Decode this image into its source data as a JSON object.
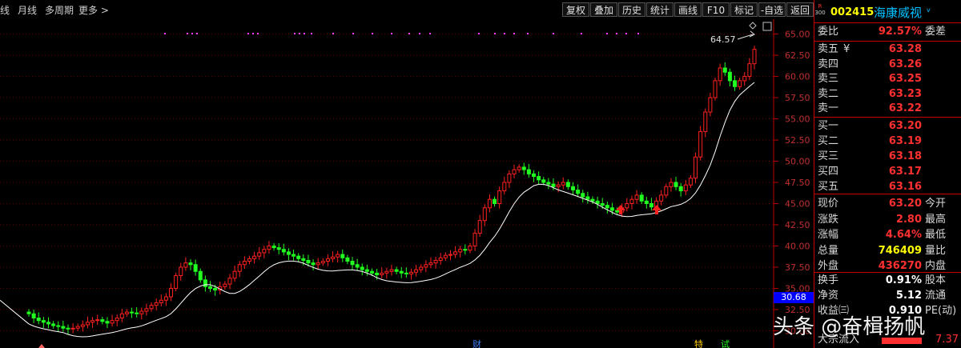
{
  "toolbar": {
    "left_items": [
      "线",
      "月线",
      "多周期",
      "更多"
    ],
    "buttons": [
      "复权",
      "叠加",
      "历史",
      "统计",
      "画线",
      "F10",
      "标记",
      "-自选",
      "返回"
    ]
  },
  "stock": {
    "code": "002415",
    "name": "海康威视",
    "prefix_top": "R",
    "prefix_bottom": "300"
  },
  "chart": {
    "y_ticks": [
      "65.00",
      "62.50",
      "60.00",
      "57.50",
      "55.00",
      "52.50",
      "50.00",
      "47.50",
      "45.00",
      "42.50",
      "40.00",
      "37.50",
      "35.00",
      "32.50",
      "30.00"
    ],
    "high_label": "64.57",
    "current_price_tag": "30.68",
    "bottom_marks": [
      "财",
      "特",
      "试"
    ]
  },
  "chart_data": {
    "type": "candlestick",
    "ylim": [
      29.0,
      66.0
    ],
    "close": [
      32.0,
      31.5,
      31.2,
      31.0,
      30.8,
      30.6,
      30.5,
      30.3,
      30.2,
      30.3,
      30.5,
      30.7,
      31.0,
      31.2,
      31.3,
      31.1,
      30.9,
      31.2,
      31.5,
      32.0,
      32.2,
      32.1,
      32.0,
      32.3,
      32.6,
      33.0,
      33.3,
      33.6,
      34.0,
      35.0,
      36.5,
      37.5,
      38.0,
      37.8,
      37.0,
      36.0,
      35.2,
      35.0,
      34.8,
      35.2,
      35.5,
      36.2,
      37.0,
      37.8,
      38.2,
      38.5,
      38.8,
      39.2,
      39.6,
      40.0,
      39.8,
      39.6,
      39.3,
      39.0,
      38.8,
      38.5,
      38.3,
      38.0,
      37.8,
      38.0,
      38.2,
      38.5,
      38.7,
      39.0,
      38.6,
      38.2,
      37.8,
      37.5,
      37.2,
      37.0,
      36.8,
      36.6,
      36.8,
      37.0,
      37.2,
      37.0,
      36.8,
      36.7,
      36.9,
      37.2,
      37.5,
      37.8,
      38.0,
      38.3,
      38.6,
      38.9,
      39.0,
      39.3,
      39.6,
      39.5,
      40.0,
      41.5,
      43.0,
      44.5,
      45.5,
      45.0,
      46.5,
      47.5,
      48.5,
      49.0,
      49.3,
      49.0,
      48.5,
      48.2,
      47.8,
      47.5,
      47.3,
      47.0,
      47.2,
      47.5,
      47.0,
      46.6,
      46.2,
      45.8,
      45.5,
      45.3,
      45.0,
      44.8,
      44.5,
      44.2,
      44.0,
      44.5,
      45.0,
      45.5,
      46.0,
      45.3,
      45.0,
      44.6,
      45.3,
      46.0,
      47.0,
      47.5,
      47.0,
      46.5,
      47.2,
      48.0,
      50.5,
      53.5,
      55.8,
      57.5,
      59.5,
      61.0,
      60.5,
      59.5,
      58.8,
      59.5,
      60.0,
      61.5,
      63.2
    ]
  },
  "panel": {
    "weibi": {
      "label": "委比",
      "value": "92.57%",
      "label2": "委差"
    },
    "asks": [
      {
        "label": "卖五",
        "extra": "¥",
        "price": "63.28"
      },
      {
        "label": "卖四",
        "extra": "",
        "price": "63.26"
      },
      {
        "label": "卖三",
        "extra": "",
        "price": "63.25"
      },
      {
        "label": "卖二",
        "extra": "",
        "price": "63.23"
      },
      {
        "label": "卖一",
        "extra": "",
        "price": "63.22"
      }
    ],
    "bids": [
      {
        "label": "买一",
        "price": "63.20"
      },
      {
        "label": "买二",
        "price": "63.19"
      },
      {
        "label": "买三",
        "price": "63.18"
      },
      {
        "label": "买四",
        "price": "63.17"
      },
      {
        "label": "买五",
        "price": "63.16"
      }
    ],
    "stats": [
      {
        "label": "现价",
        "value": "63.20",
        "label2": "今开",
        "cls": "red"
      },
      {
        "label": "涨跌",
        "value": "2.80",
        "label2": "最高",
        "cls": "red"
      },
      {
        "label": "涨幅",
        "value": "4.64%",
        "label2": "最低",
        "cls": "red"
      },
      {
        "label": "总量",
        "value": "746409",
        "label2": "量比",
        "cls": "yel"
      },
      {
        "label": "外盘",
        "value": "436270",
        "label2": "内盘",
        "cls": "red"
      }
    ],
    "stats2": [
      {
        "label": "换手",
        "value": "0.91%",
        "label2": "股本",
        "cls": "wht"
      },
      {
        "label": "净资",
        "value": "5.12",
        "label2": "流通",
        "cls": "wht"
      },
      {
        "label": "收益㈢",
        "value": "0.910",
        "label2": "PE(动)",
        "cls": "wht"
      }
    ],
    "bottom_label": "大宗流入",
    "bottom_value": "7.37"
  },
  "watermark": "头条 @奋楫扬帆"
}
